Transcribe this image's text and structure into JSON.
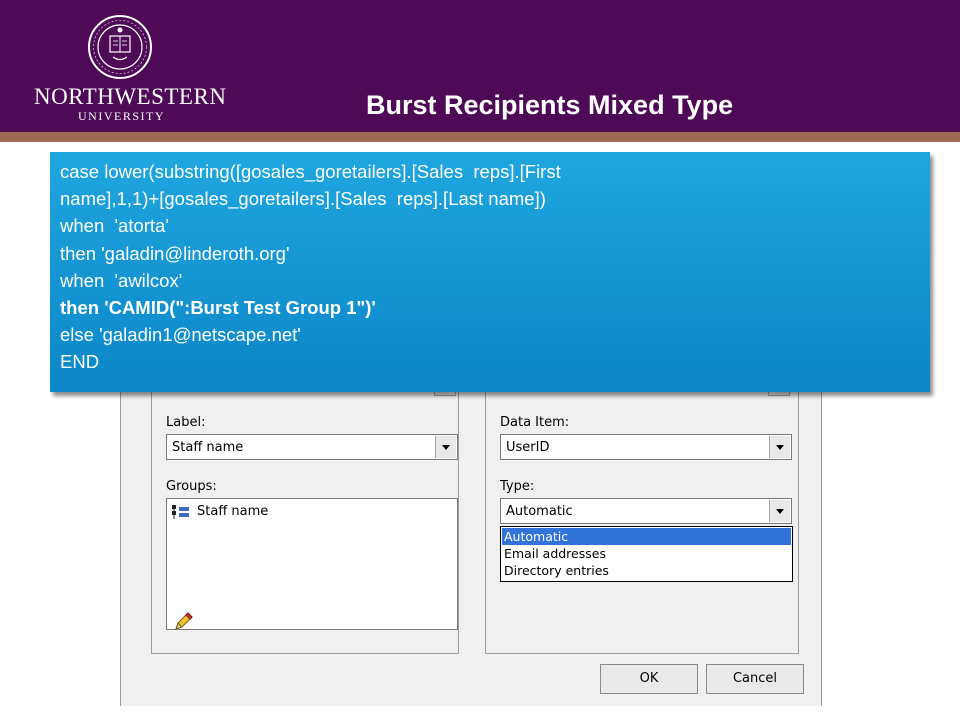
{
  "header": {
    "logo_word": "NORTHWESTERN",
    "logo_sub": "UNIVERSITY",
    "title": "Burst Recipients Mixed Type",
    "brand_color": "#4f0a57",
    "rule_color": "#a06a50"
  },
  "callout": {
    "color": "#1a9cd8",
    "lines": [
      "case lower(substring([gosales_goretailers].[Sales  reps].[First",
      "name],1,1)+[gosales_goretailers].[Sales  reps].[Last name])",
      "when  'atorta'",
      "then 'galadin@linderoth.org'",
      "when  'awilcox'",
      "then 'CAMID(\":Burst Test Group 1\")'",
      "else 'galadin1@netscape.net'",
      "END"
    ]
  },
  "dialog": {
    "left": {
      "label_label": "Label:",
      "label_value": "Staff name",
      "groups_label": "Groups:",
      "groups_item": "Staff name",
      "edit_icon": "pencil-icon",
      "group_icon": "group-tree-icon"
    },
    "right": {
      "data_item_label": "Data Item:",
      "data_item_value": "UserID",
      "type_label": "Type:",
      "type_value": "Automatic",
      "type_options": [
        "Automatic",
        "Email addresses",
        "Directory entries"
      ]
    },
    "ok_label": "OK",
    "cancel_label": "Cancel"
  }
}
